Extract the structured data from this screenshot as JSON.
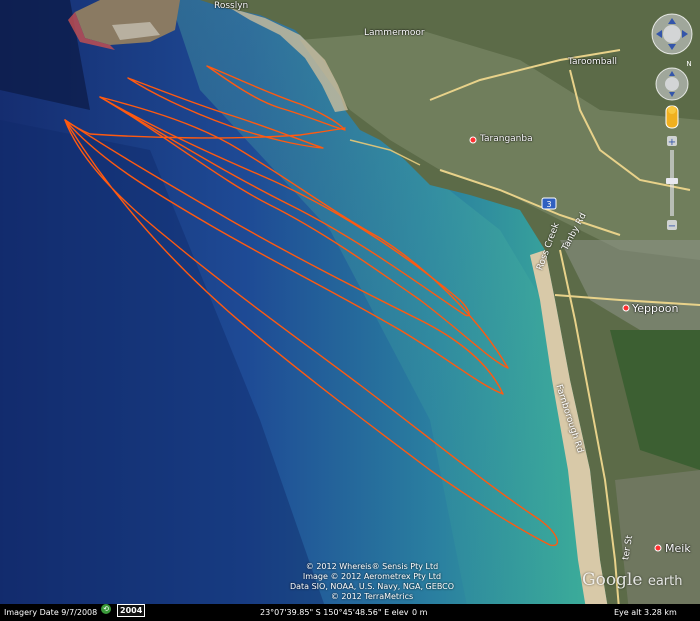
{
  "places": {
    "rosslyn": "Rosslyn",
    "lammermoor": "Lammermoor",
    "taroomball": "Taroomball",
    "taranganba": "Taranganba",
    "yeppoon": "Yeppoon",
    "meikleville": "Meik"
  },
  "roads": {
    "route_shield": "3",
    "road_1": "Ross Creek",
    "road_2": "Farnborough Rd",
    "road_3": "Tanby Rd",
    "road_4": "ter St"
  },
  "credits": [
    "© 2012 Whereis® Sensis Pty Ltd",
    "Image © 2012 Aerometrex Pty Ltd",
    "Data SIO, NOAA, U.S. Navy, NGA, GEBCO",
    "© 2012 TerraMetrics"
  ],
  "logo": {
    "main": "Google",
    "sub": "earth"
  },
  "status": {
    "imagery_date": "Imagery Date 9/7/2008",
    "year": "2004",
    "coordinates": "23°07'39.85\" S 150°45'48.56\" E elev",
    "elevation": "0 m",
    "eye_alt": "Eye alt 3.28 km"
  },
  "nav": {
    "north_label": "N"
  },
  "colors": {
    "track": "#ff5a10",
    "water_deep": "#1a3d8a",
    "water_shallow": "#3aa898",
    "land": "#5a6a4a"
  }
}
